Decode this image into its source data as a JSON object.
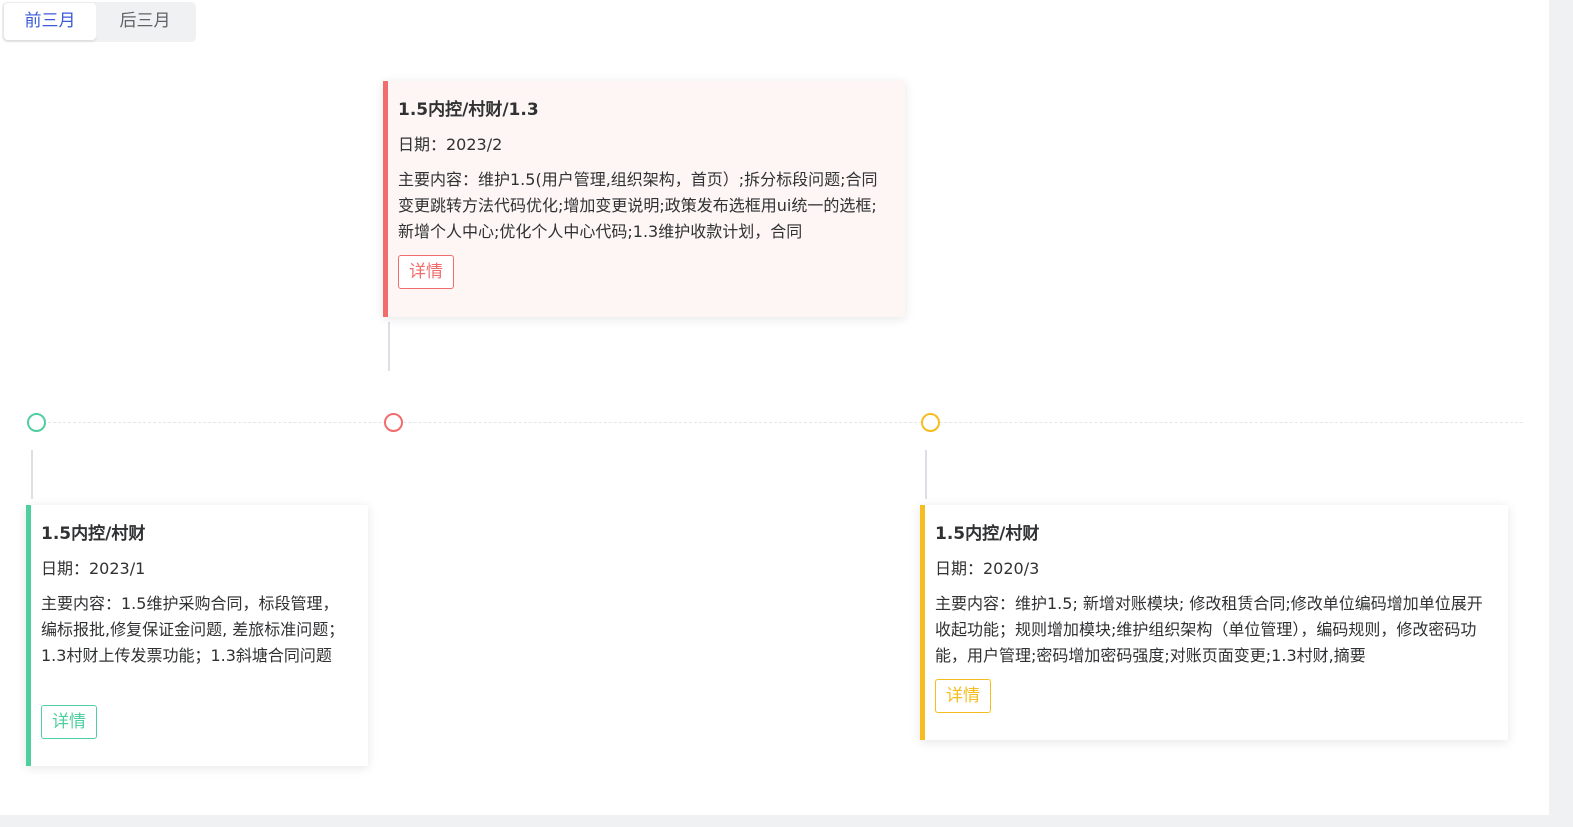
{
  "tabs": [
    {
      "label": "前三月",
      "active": true
    },
    {
      "label": "后三月",
      "active": false
    }
  ],
  "colors": {
    "red": "#f16c6c",
    "green": "#4fcf9f",
    "yellow": "#f5bd1f",
    "tab_active": "#3b5bdb"
  },
  "cards": [
    {
      "title": "1.5内控/村财/1.3",
      "date": "日期：2023/2",
      "content": "主要内容：维护1.5(用户管理,组织架构，首页）;拆分标段问题;合同变更跳转方法代码优化;增加变更说明;政策发布选框用ui统一的选框;新增个人中心;优化个人中心代码;1.3维护收款计划，合同",
      "detail": "详情",
      "color": "red"
    },
    {
      "title": "1.5内控/村财",
      "date": "日期：2023/1",
      "content": "主要内容：1.5维护采购合同，标段管理，编标报批,修复保证金问题, 差旅标准问题；1.3村财上传发票功能；1.3斜塘合同问题",
      "detail": "详情",
      "color": "green"
    },
    {
      "title": "1.5内控/村财",
      "date": "日期：2020/3",
      "content": "主要内容：维护1.5; 新增对账模块; 修改租赁合同;修改单位编码增加单位展开收起功能；规则增加模块;维护组织架构（单位管理），编码规则，修改密码功能，用户管理;密码增加密码强度;对账页面变更;1.3村财,摘要",
      "detail": "详情",
      "color": "yellow"
    }
  ]
}
